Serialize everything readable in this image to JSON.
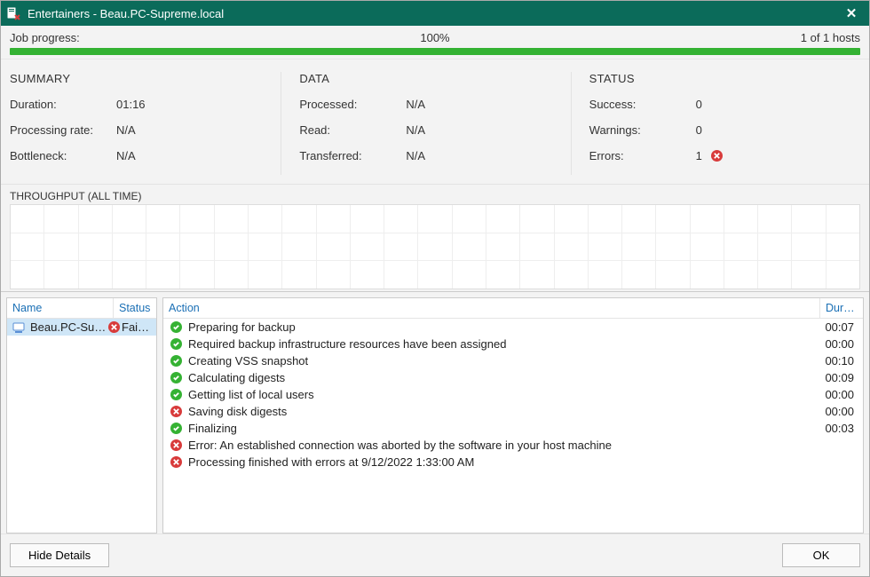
{
  "window": {
    "title": "Entertainers - Beau.PC-Supreme.local"
  },
  "progress": {
    "label": "Job progress:",
    "percent_text": "100%",
    "hosts_text": "1 of 1 hosts"
  },
  "summary": {
    "heading": "SUMMARY",
    "rows": {
      "duration_label": "Duration:",
      "duration_value": "01:16",
      "rate_label": "Processing rate:",
      "rate_value": "N/A",
      "bottleneck_label": "Bottleneck:",
      "bottleneck_value": "N/A"
    }
  },
  "data": {
    "heading": "DATA",
    "rows": {
      "processed_label": "Processed:",
      "processed_value": "N/A",
      "read_label": "Read:",
      "read_value": "N/A",
      "transferred_label": "Transferred:",
      "transferred_value": "N/A"
    }
  },
  "status": {
    "heading": "STATUS",
    "rows": {
      "success_label": "Success:",
      "success_value": "0",
      "warnings_label": "Warnings:",
      "warnings_value": "0",
      "errors_label": "Errors:",
      "errors_value": "1"
    }
  },
  "throughput": {
    "label": "THROUGHPUT (ALL TIME)"
  },
  "hosts": {
    "col_name": "Name",
    "col_status": "Status",
    "items": [
      {
        "name": "Beau.PC-Sup…",
        "status_text": "Fai…",
        "status": "error"
      }
    ]
  },
  "actions": {
    "col_action": "Action",
    "col_duration": "Dura…",
    "items": [
      {
        "icon": "success",
        "text": "Preparing for backup",
        "duration": "00:07"
      },
      {
        "icon": "success",
        "text": "Required backup infrastructure resources have been assigned",
        "duration": "00:00"
      },
      {
        "icon": "success",
        "text": "Creating VSS snapshot",
        "duration": "00:10"
      },
      {
        "icon": "success",
        "text": "Calculating digests",
        "duration": "00:09"
      },
      {
        "icon": "success",
        "text": "Getting list of local users",
        "duration": "00:00"
      },
      {
        "icon": "error",
        "text": "Saving disk digests",
        "duration": "00:00"
      },
      {
        "icon": "success",
        "text": "Finalizing",
        "duration": "00:03"
      },
      {
        "icon": "error",
        "text": "Error: An established connection was aborted by the software in your host machine",
        "duration": ""
      },
      {
        "icon": "error",
        "text": "Processing finished with errors at 9/12/2022 1:33:00 AM",
        "duration": ""
      }
    ]
  },
  "footer": {
    "hide_details": "Hide Details",
    "ok": "OK"
  },
  "icons": {
    "close": "✕"
  }
}
